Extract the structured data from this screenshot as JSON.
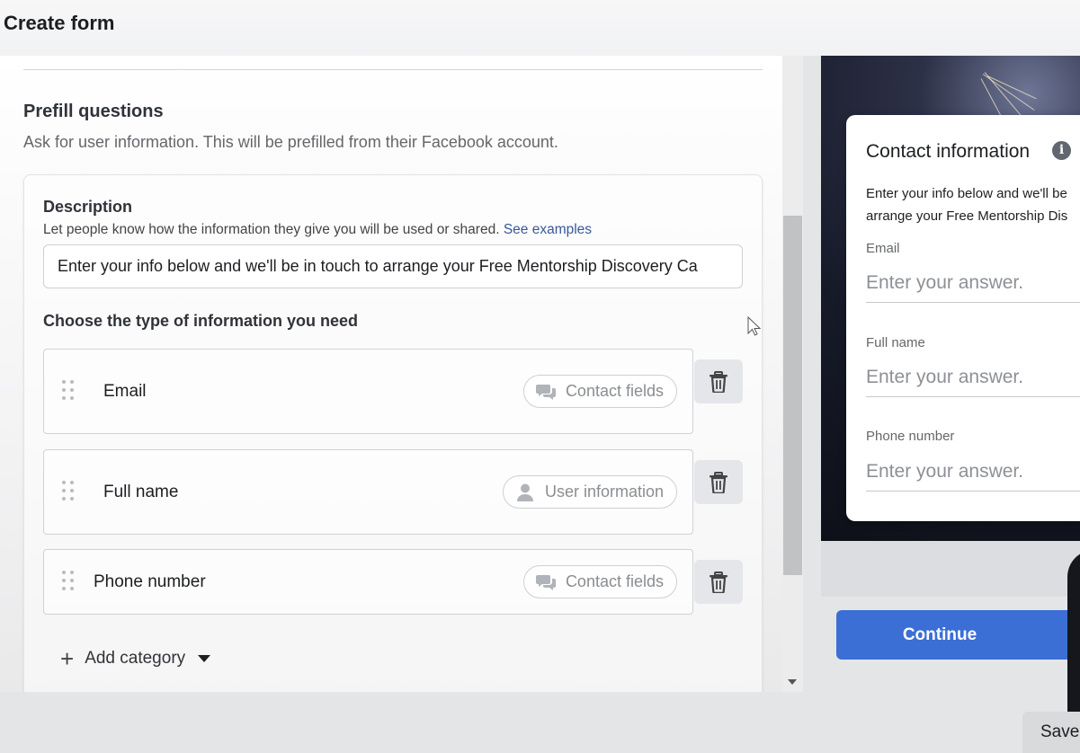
{
  "header": {
    "title": "Create form"
  },
  "prefill": {
    "title": "Prefill questions",
    "subtitle": "Ask for user information. This will be prefilled from their Facebook account."
  },
  "description": {
    "label": "Description",
    "help_text": "Let people know how the information they give you will be used or shared.",
    "see_examples": "See examples",
    "value": "Enter your info below and we'll be in touch to arrange your Free Mentorship Discovery Ca"
  },
  "choose": {
    "label": "Choose the type of information you need"
  },
  "questions": [
    {
      "label": "Email",
      "category": "Contact fields",
      "category_icon": "chat-bubbles-icon"
    },
    {
      "label": "Full name",
      "category": "User information",
      "category_icon": "person-icon"
    },
    {
      "label": "Phone number",
      "category": "Contact fields",
      "category_icon": "chat-bubbles-icon"
    }
  ],
  "add_category": {
    "label": "Add category"
  },
  "preview": {
    "title": "Contact information",
    "desc_line1": "Enter your info below and we'll be",
    "desc_line2": "arrange your Free Mentorship Dis",
    "fields": [
      {
        "label": "Email",
        "placeholder": "Enter your answer."
      },
      {
        "label": "Full name",
        "placeholder": "Enter your answer."
      },
      {
        "label": "Phone number",
        "placeholder": "Enter your answer."
      }
    ],
    "continue_label": "Continue"
  },
  "footer": {
    "save_label": "Save"
  },
  "colors": {
    "accent": "#3b6fd6",
    "link": "#385898"
  }
}
